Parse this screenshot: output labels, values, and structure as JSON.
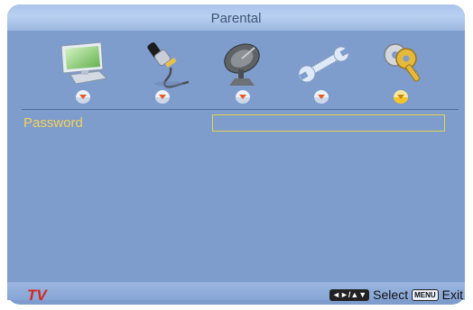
{
  "menu": {
    "title": "Parental",
    "icons": [
      {
        "name": "monitor-icon",
        "selected": false
      },
      {
        "name": "audio-plug-icon",
        "selected": false
      },
      {
        "name": "satellite-dish-icon",
        "selected": false
      },
      {
        "name": "wrench-icon",
        "selected": false
      },
      {
        "name": "key-icon",
        "selected": true
      }
    ],
    "colors": {
      "background": "#7e9ccc",
      "highlight": "#f2d15a",
      "marker": "#e45a24",
      "marker_selected": "#f6c42a",
      "brand": "#d7261d"
    }
  },
  "items": {
    "password_label": "Password",
    "password_value": ""
  },
  "footer": {
    "brand": "TV",
    "nav_key": "◄►/▲▼",
    "select_label": "Select",
    "menu_key": "MENU",
    "exit_label": "Exit"
  }
}
